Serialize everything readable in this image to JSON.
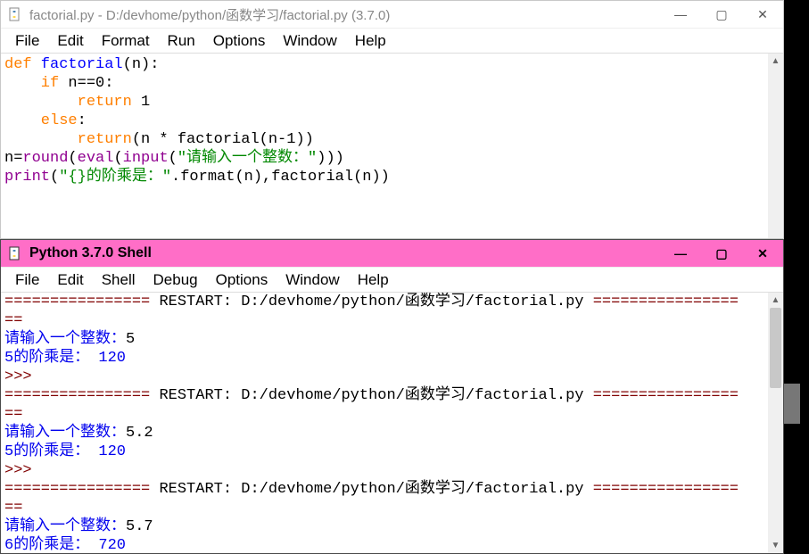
{
  "editor": {
    "title": "factorial.py - D:/devhome/python/函数学习/factorial.py (3.7.0)",
    "menus": [
      "File",
      "Edit",
      "Format",
      "Run",
      "Options",
      "Window",
      "Help"
    ],
    "win_min": "—",
    "win_max": "▢",
    "win_close": "✕",
    "code": {
      "l1a": "def",
      "l1b": " factorial",
      "l1c": "(n):",
      "l2a": "    if",
      "l2b": " n==0:",
      "l3a": "        return",
      "l3b": " 1",
      "l4a": "    else",
      "l4b": ":",
      "l5a": "        return",
      "l5b": "(n * factorial(n-1))",
      "l6a": "n=",
      "l6b": "round",
      "l6c": "(",
      "l6d": "eval",
      "l6e": "(",
      "l6f": "input",
      "l6g": "(",
      "l6h": "\"请输入一个整数：\"",
      "l6i": ")))",
      "l7a": "print",
      "l7b": "(",
      "l7c": "\"{}的阶乘是：\"",
      "l7d": ".format(n),factorial(n))"
    }
  },
  "shell": {
    "title": "Python 3.7.0 Shell",
    "menus": [
      "File",
      "Edit",
      "Shell",
      "Debug",
      "Options",
      "Window",
      "Help"
    ],
    "win_min": "—",
    "win_max": "▢",
    "win_close": "✕",
    "out": {
      "restart1a": "================ ",
      "restart1b": "RESTART: D:/devhome/python/函数学习/factorial.py",
      "restart1c": " ================",
      "eq": "==",
      "prompt1": "请输入一个整数：",
      "input1": "5",
      "result1": "5的阶乘是： 120",
      "ps": ">>> ",
      "restart2a": "================ ",
      "restart2b": "RESTART: D:/devhome/python/函数学习/factorial.py",
      "restart2c": " ================",
      "prompt2": "请输入一个整数：",
      "input2": "5.2",
      "result2": "5的阶乘是： 120",
      "restart3a": "================ ",
      "restart3b": "RESTART: D:/devhome/python/函数学习/factorial.py",
      "restart3c": " ================",
      "prompt3": "请输入一个整数：",
      "input3": "5.7",
      "result3": "6的阶乘是： 720"
    }
  }
}
